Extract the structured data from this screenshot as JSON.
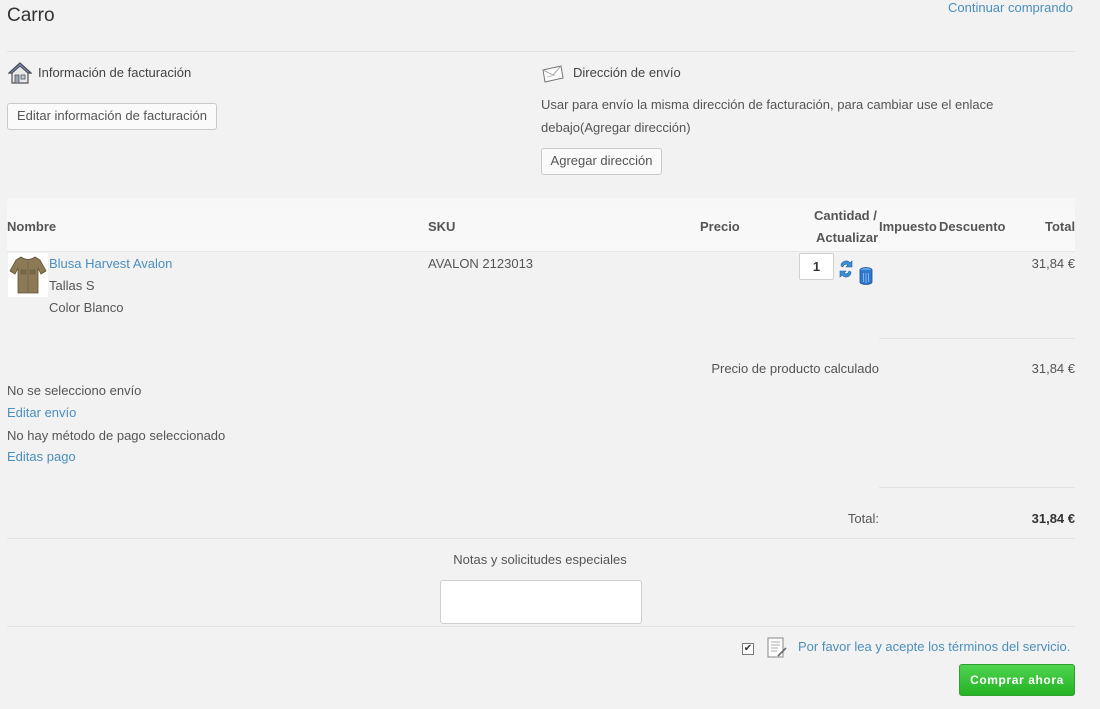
{
  "header": {
    "title": "Carro",
    "continue_link": "Continuar comprando"
  },
  "billing": {
    "title": "Información de facturación",
    "edit_button": "Editar información de facturación"
  },
  "shipping": {
    "title": "Dirección de envío",
    "note_line1": "Usar para envío la misma dirección de facturación, para cambiar use el enlace",
    "note_line2": "debajo(Agregar dirección)",
    "add_button": "Agregar dirección"
  },
  "table": {
    "headers": {
      "name": "Nombre",
      "sku": "SKU",
      "price": "Precio",
      "qty_line1": "Cantidad /",
      "qty_line2": "Actualizar",
      "tax": "Impuesto",
      "discount": "Descuento",
      "total": "Total"
    },
    "rows": [
      {
        "name": "Blusa Harvest Avalon",
        "attr1": "Tallas S",
        "attr2": "Color Blanco",
        "sku": "AVALON 2123013",
        "quantity": "1",
        "total": "31,84 €"
      }
    ]
  },
  "summary": {
    "product_price_label": "Precio de producto calculado",
    "product_price_value": "31,84 €",
    "shipping_status": "No se selecciono envío",
    "edit_shipping_link": "Editar envío",
    "payment_status": "No hay método de pago seleccionado",
    "edit_payment_link": "Editas pago",
    "total_label": "Total:",
    "total_value": "31,84 €"
  },
  "notes": {
    "label": "Notas y solicitudes especiales",
    "value": ""
  },
  "terms": {
    "checked": true,
    "link": "Por favor lea y acepte los términos del servicio."
  },
  "buy_button": "Comprar ahora",
  "icons": {
    "billing": "house-icon",
    "shipping": "envelope-icon",
    "product": "shirt-thumbnail",
    "update": "refresh-icon",
    "delete": "trash-icon",
    "terms": "document-icon"
  },
  "colors": {
    "link": "#4a8fbd",
    "buy_button": "#2fbf2f",
    "background": "#f2f2f2"
  }
}
